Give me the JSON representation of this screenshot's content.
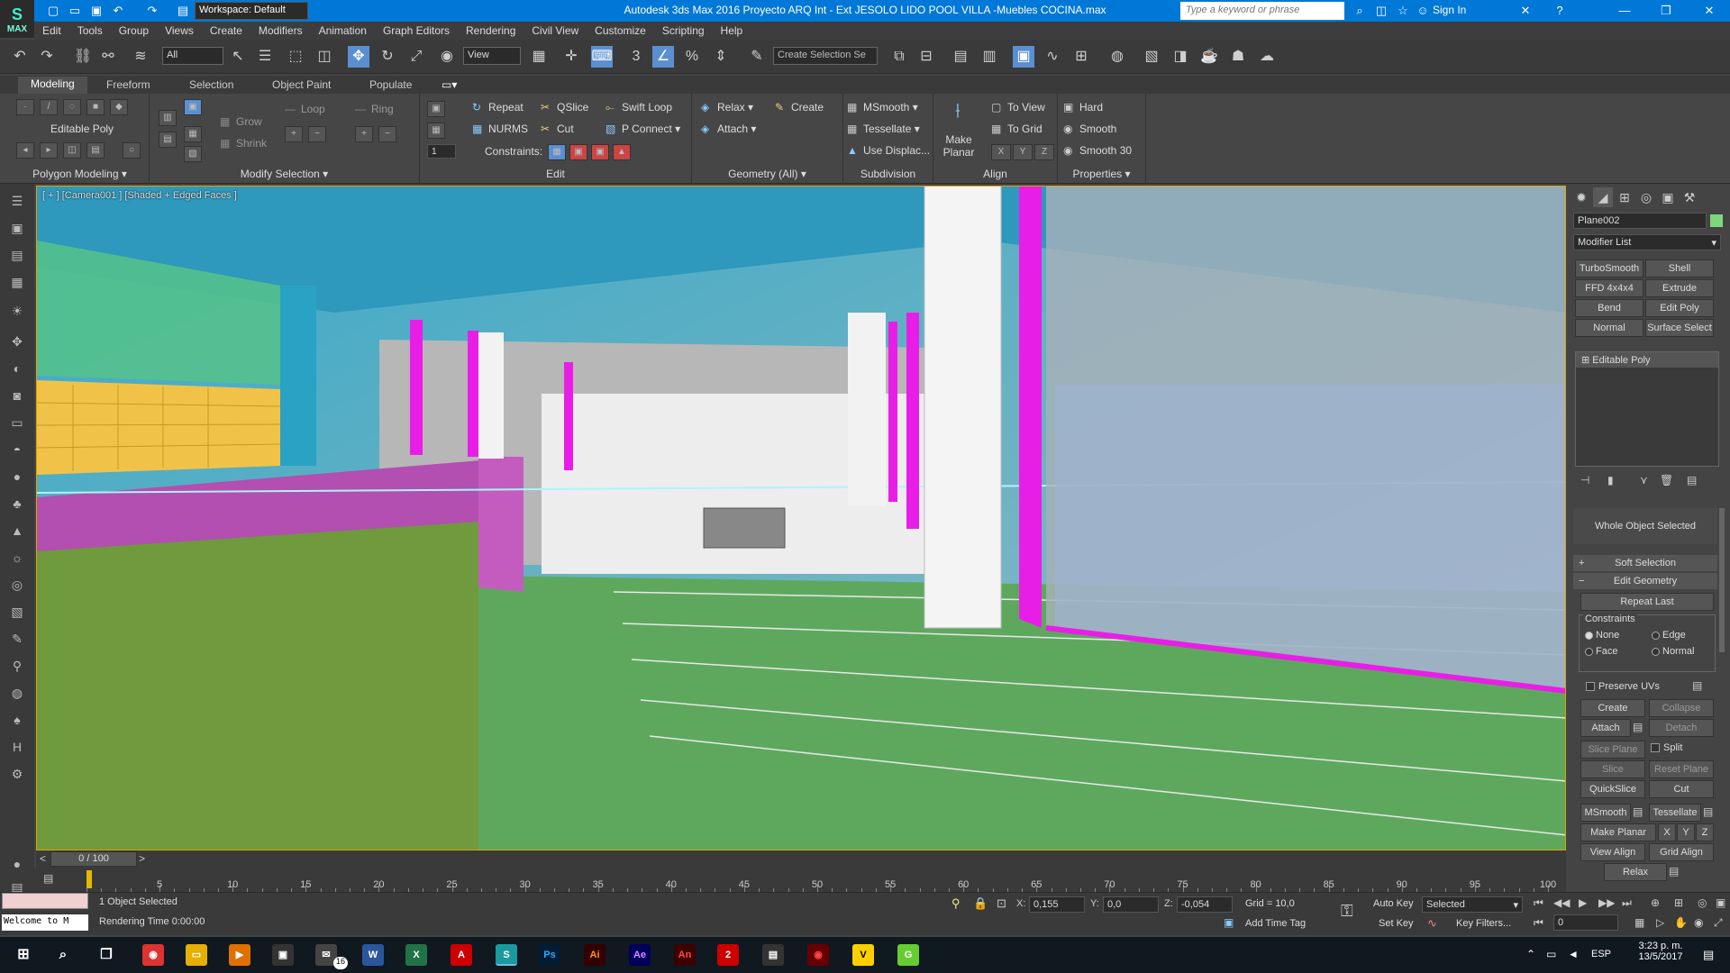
{
  "title_bar": {
    "text": "Autodesk 3ds Max 2016     Proyecto ARQ Int - Ext JESOLO LIDO POOL VILLA -Muebles COCINA.max",
    "workspace": "Workspace: Default",
    "search_placeholder": "Type a keyword or phrase",
    "sign_in": "Sign In",
    "logo": "MAX"
  },
  "menu": [
    "Edit",
    "Tools",
    "Group",
    "Views",
    "Create",
    "Modifiers",
    "Animation",
    "Graph Editors",
    "Rendering",
    "Civil View",
    "Customize",
    "Scripting",
    "Help"
  ],
  "toolbar": {
    "selection_filter": "All",
    "ref_coord": "View",
    "named_selection_placeholder": "Create Selection Se"
  },
  "ribbon_tabs": [
    "Modeling",
    "Freeform",
    "Selection",
    "Object Paint",
    "Populate"
  ],
  "ribbon": {
    "polygon_modeling": {
      "label": "Editable Poly",
      "footer": "Polygon Modeling ▾"
    },
    "modify_selection": {
      "grow": "Grow",
      "shrink": "Shrink",
      "loop": "Loop",
      "ring": "Ring",
      "footer": "Modify Selection ▾"
    },
    "edit": {
      "repeat": "Repeat",
      "qslice": "QSlice",
      "swift_loop": "Swift Loop",
      "nurms": "NURMS",
      "cut": "Cut",
      "p_connect": "P Connect",
      "constraints": "Constraints:",
      "spinner": "1",
      "footer": "Edit"
    },
    "geometry": {
      "relax": "Relax",
      "create": "Create",
      "attach": "Attach",
      "footer": "Geometry (All) ▾"
    },
    "subdivision": {
      "msmooth": "MSmooth",
      "tessellate": "Tessellate",
      "use_displac": "Use Displac...",
      "footer": "Subdivision"
    },
    "align": {
      "make_planar": "Make Planar",
      "x": "X",
      "y": "Y",
      "z": "Z",
      "to_view": "To View",
      "to_grid": "To Grid",
      "footer": "Align"
    },
    "properties": {
      "hard": "Hard",
      "smooth": "Smooth",
      "smooth30": "Smooth 30",
      "footer": "Properties ▾"
    }
  },
  "viewport": {
    "label": "[ + ] [Camera001 ] [Shaded + Edged Faces ]"
  },
  "command_panel": {
    "object_name": "Plane002",
    "modifier_list": "Modifier List",
    "modifier_buttons": [
      "TurboSmooth",
      "Shell",
      "FFD 4x4x4",
      "Extrude",
      "Bend",
      "Edit Poly",
      "Normal",
      "Surface Select"
    ],
    "stack_item": "Editable Poly",
    "whole_object": "Whole Object Selected",
    "soft_selection": "Soft Selection",
    "edit_geometry": "Edit Geometry",
    "repeat_last": "Repeat Last",
    "constraints_label": "Constraints",
    "constraints": [
      "None",
      "Edge",
      "Face",
      "Normal"
    ],
    "preserve_uvs": "Preserve UVs",
    "buttons": {
      "create": "Create",
      "collapse": "Collapse",
      "attach": "Attach",
      "detach": "Detach",
      "slice_plane": "Slice Plane",
      "split": "Split",
      "slice": "Slice",
      "reset_plane": "Reset Plane",
      "quickslice": "QuickSlice",
      "cut": "Cut",
      "msmooth": "MSmooth",
      "tessellate": "Tessellate",
      "make_planar": "Make Planar",
      "x": "X",
      "y": "Y",
      "z": "Z",
      "view_align": "View Align",
      "grid_align": "Grid Align",
      "relax": "Relax"
    }
  },
  "timeline": {
    "frame": "0 / 100",
    "ticks": [
      "5",
      "10",
      "15",
      "20",
      "25",
      "30",
      "35",
      "40",
      "45",
      "50",
      "55",
      "60",
      "65",
      "70",
      "75",
      "80",
      "85",
      "90",
      "95",
      "100"
    ]
  },
  "status": {
    "maxscript": "Welcome to M",
    "selected": "1 Object Selected",
    "render_time": "Rendering Time  0:00:00",
    "x_label": "X:",
    "x": "0,155",
    "y_label": "Y:",
    "y": "0,0",
    "z_label": "Z:",
    "z": "-0,054",
    "grid": "Grid = 10,0",
    "add_time_tag": "Add Time Tag",
    "auto_key": "Auto Key",
    "set_key": "Set Key",
    "selected_dropdown": "Selected",
    "key_filters": "Key Filters...",
    "frame_field": "0"
  },
  "taskbar": {
    "time": "3:23 p. m.",
    "date": "13/5/2017",
    "lang": "ESP",
    "notif_badge": "16",
    "apps": [
      "Chrome",
      "Explorer",
      "Media",
      "Store",
      "Mail",
      "W",
      "X",
      "Acrobat",
      "3ds",
      "Ps",
      "Ai",
      "Ae",
      "An",
      "Gen",
      "Arch",
      "Ai2",
      "V",
      "G"
    ]
  }
}
